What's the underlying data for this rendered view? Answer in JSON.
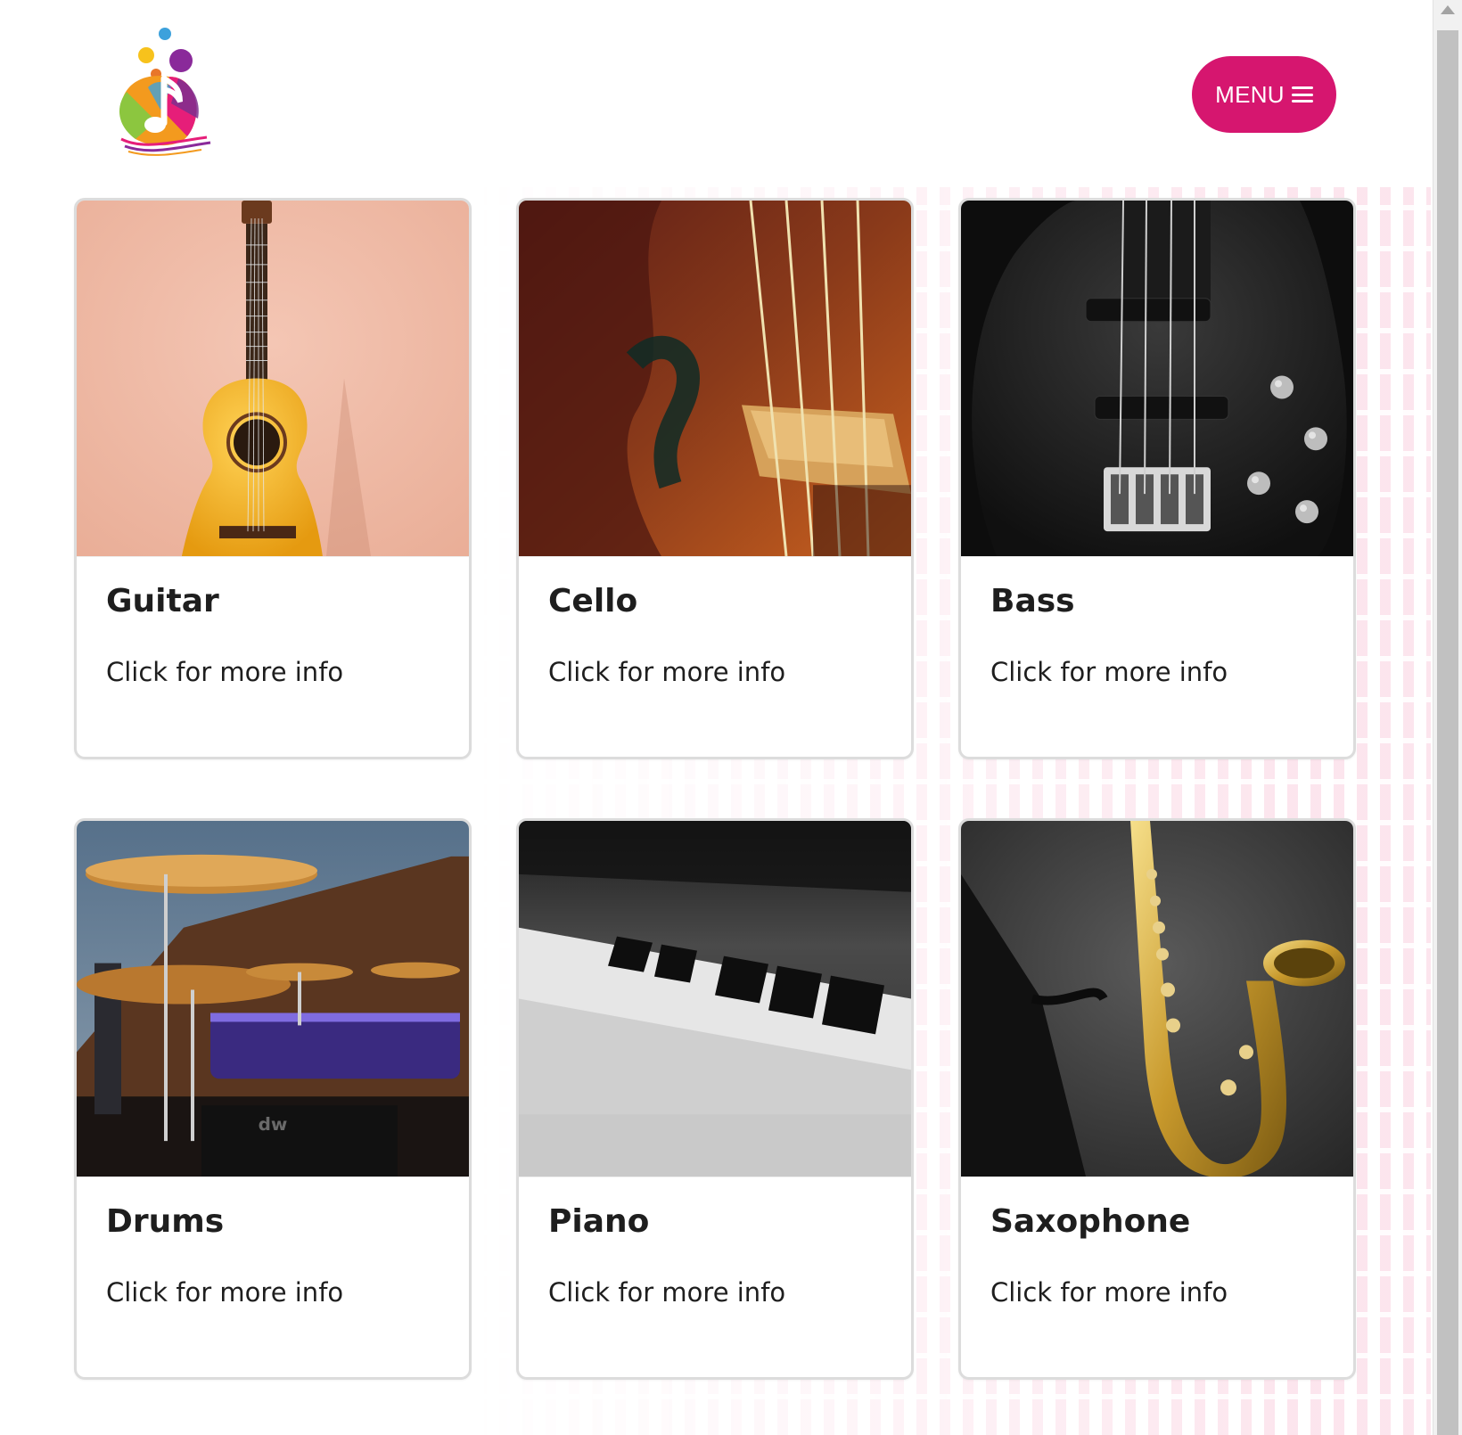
{
  "header": {
    "logo_icon": "music-note-logo",
    "menu": {
      "label": "MENU",
      "icon": "hamburger-icon"
    }
  },
  "colors": {
    "accent": "#d6166f",
    "card_border": "#dcdcdc",
    "text": "#1e1e1e"
  },
  "cards": [
    {
      "title": "Guitar",
      "subtitle": "Click for more info",
      "image": "acoustic-guitar-photo"
    },
    {
      "title": "Cello",
      "subtitle": "Click for more info",
      "image": "cello-photo"
    },
    {
      "title": "Bass",
      "subtitle": "Click for more info",
      "image": "bass-guitar-photo"
    },
    {
      "title": "Drums",
      "subtitle": "Click for more info",
      "image": "drum-kit-photo"
    },
    {
      "title": "Piano",
      "subtitle": "Click for more info",
      "image": "piano-keys-photo"
    },
    {
      "title": "Saxophone",
      "subtitle": "Click for more info",
      "image": "saxophone-photo"
    }
  ]
}
